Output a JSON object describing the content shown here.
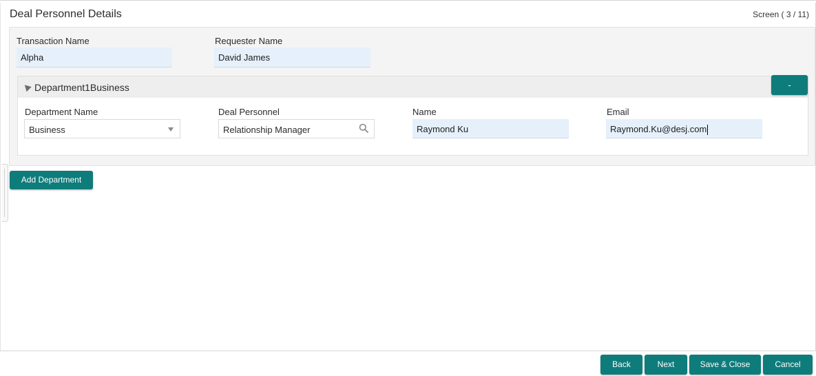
{
  "header": {
    "title": "Deal Personnel Details",
    "screen_count": "Screen ( 3 / 11)"
  },
  "transaction": {
    "name_label": "Transaction Name",
    "name_value": "Alpha",
    "requester_label": "Requester Name",
    "requester_value": "David James"
  },
  "department": {
    "section_title": "Department1Business",
    "remove_label": "-",
    "dept_name_label": "Department Name",
    "dept_name_value": "Business",
    "personnel_label": "Deal Personnel",
    "personnel_value": "Relationship Manager",
    "name_label": "Name",
    "name_value": "Raymond Ku",
    "email_label": "Email",
    "email_value": "Raymond.Ku@desj.com"
  },
  "actions": {
    "add_department": "Add Department",
    "back": "Back",
    "next": "Next",
    "save_close": "Save & Close",
    "cancel": "Cancel"
  },
  "icons": {
    "collapse": "triangle-collapse-icon",
    "dropdown": "chevron-down-icon",
    "search": "search-icon"
  },
  "colors": {
    "accent": "#0e7c7b",
    "readonly_field": "#e5f0fb"
  }
}
